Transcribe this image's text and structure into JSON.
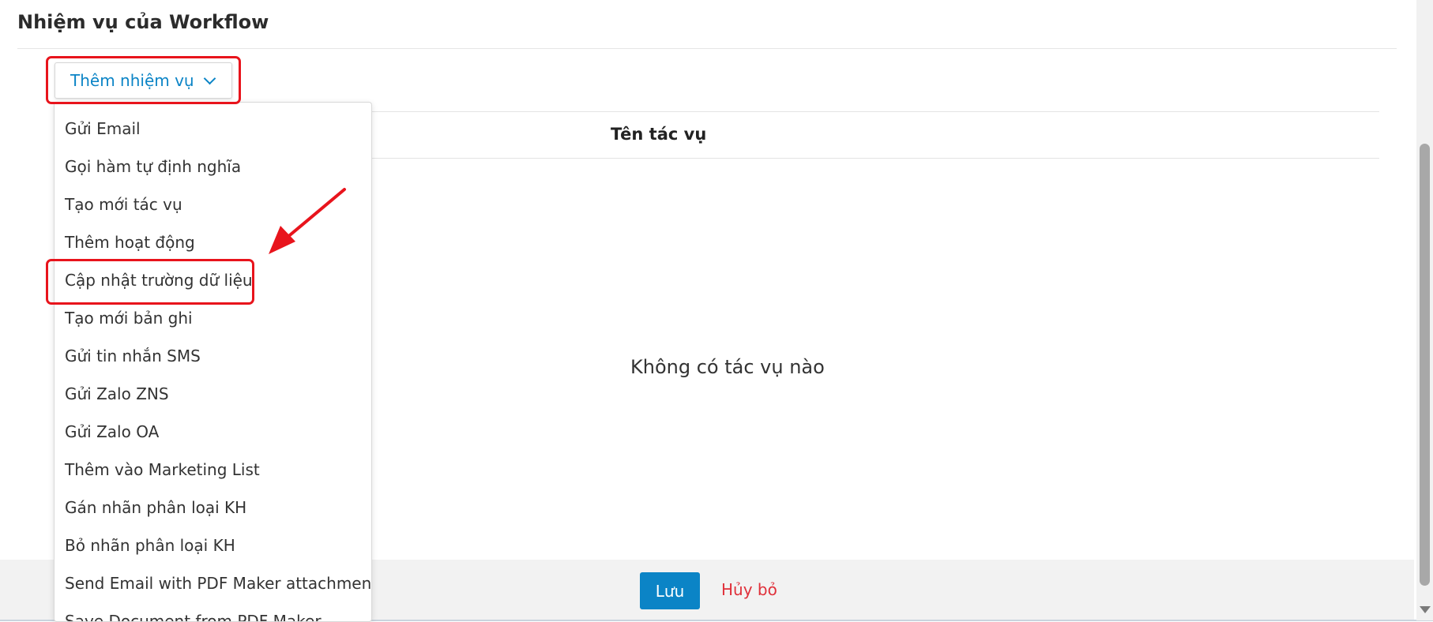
{
  "page": {
    "title": "Nhiệm vụ của Workflow"
  },
  "toolbar": {
    "add_task_label": "Thêm nhiệm vụ"
  },
  "dropdown": {
    "items": [
      {
        "label": "Gửi Email"
      },
      {
        "label": "Gọi hàm tự định nghĩa"
      },
      {
        "label": "Tạo mới tác vụ"
      },
      {
        "label": "Thêm hoạt động"
      },
      {
        "label": "Cập nhật trường dữ liệu"
      },
      {
        "label": "Tạo mới bản ghi"
      },
      {
        "label": "Gửi tin nhắn SMS"
      },
      {
        "label": "Gửi Zalo ZNS"
      },
      {
        "label": "Gửi Zalo OA"
      },
      {
        "label": "Thêm vào Marketing List"
      },
      {
        "label": "Gán nhãn phân loại KH"
      },
      {
        "label": "Bỏ nhãn phân loại KH"
      },
      {
        "label": "Send Email with PDF Maker attachments"
      },
      {
        "label": "Save Document from PDF Maker"
      }
    ]
  },
  "table": {
    "column_header": "Tên tác vụ",
    "empty_message": "Không có tác vụ nào"
  },
  "footer": {
    "save_label": "Lưu",
    "cancel_label": "Hủy bỏ"
  },
  "colors": {
    "accent": "#0b84c6",
    "highlight": "#e8141c",
    "cancel": "#e0303a"
  }
}
